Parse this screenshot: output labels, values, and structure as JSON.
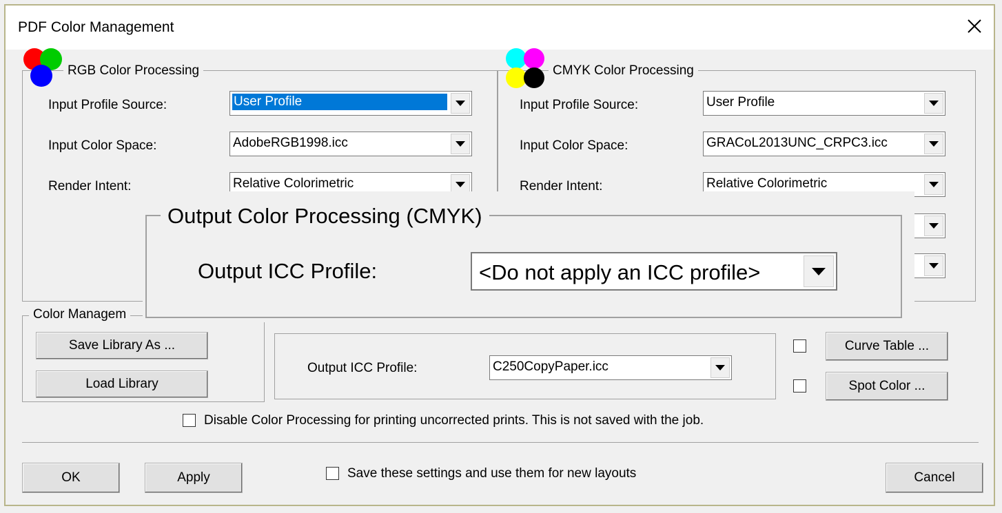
{
  "window": {
    "title": "PDF Color Management"
  },
  "rgb": {
    "group_label": "RGB Color Processing",
    "input_profile_source_label": "Input Profile Source:",
    "input_profile_source_value": "User Profile",
    "input_color_space_label": "Input Color Space:",
    "input_color_space_value": "AdobeRGB1998.icc",
    "render_intent_label": "Render Intent:",
    "render_intent_value": "Relative Colorimetric"
  },
  "cmyk": {
    "group_label": "CMYK Color Processing",
    "input_profile_source_label": "Input Profile Source:",
    "input_profile_source_value": "User Profile",
    "input_color_space_label": "Input Color Space:",
    "input_color_space_value": "GRACoL2013UNC_CRPC3.icc",
    "render_intent_label": "Render Intent:",
    "render_intent_value": "Relative Colorimetric"
  },
  "library": {
    "group_label": "Color Managem",
    "save_library_as": "Save Library As ...",
    "load_library": "Load Library"
  },
  "output": {
    "icc_profile_label": "Output ICC Profile:",
    "icc_profile_value": "C250CopyPaper.icc"
  },
  "side_buttons": {
    "curve_table": "Curve Table ...",
    "spot_color": "Spot Color ..."
  },
  "overlay": {
    "group_label": "Output Color Processing (CMYK)",
    "icc_profile_label": "Output ICC Profile:",
    "icc_profile_value": "<Do not apply an ICC profile>"
  },
  "disable_processing": {
    "label": "Disable Color Processing for printing uncorrected prints. This is not saved with the job.",
    "checked": false
  },
  "save_settings": {
    "label": "Save these settings and use them for new layouts",
    "checked": false
  },
  "footer": {
    "ok": "OK",
    "apply": "Apply",
    "cancel": "Cancel"
  },
  "icons": {
    "rgb": [
      "#ff0000",
      "#00cc00",
      "#0000ff"
    ],
    "cmyk": [
      "#00ffff",
      "#ff00ff",
      "#ffff00",
      "#000000"
    ]
  }
}
